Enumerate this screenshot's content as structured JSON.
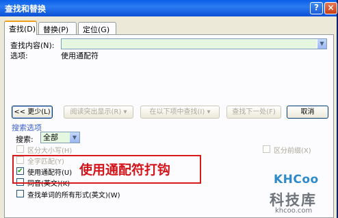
{
  "window": {
    "title": "查找和替换",
    "help_icon": "?",
    "close_icon": "×"
  },
  "tabs": [
    {
      "label": "查找(D)",
      "active": true
    },
    {
      "label": "替换(P)",
      "active": false
    },
    {
      "label": "定位(G)",
      "active": false
    }
  ],
  "find": {
    "label": "查找内容(N):",
    "value": "",
    "options_label": "选项:",
    "options_value": "使用通配符"
  },
  "buttons": {
    "less": "<< 更少(L)",
    "reading_highlight": "阅读突出显示(R) ▾",
    "find_in": "在以下项中查找(I) ▾",
    "find_next": "查找下一处(F)",
    "cancel": "取消"
  },
  "search_options": {
    "title": "搜索选项",
    "search_label": "搜索:",
    "search_value": "全部",
    "checkboxes": [
      {
        "label": "区分大小写(H)",
        "checked": false,
        "enabled": false
      },
      {
        "label": "全字匹配(Y)",
        "checked": false,
        "enabled": false
      },
      {
        "label": "使用通配符(U)",
        "checked": true,
        "enabled": true
      },
      {
        "label": "同音(英文)(K)",
        "checked": false,
        "enabled": true
      },
      {
        "label": "查找单词的所有形式(英文)(W)",
        "checked": false,
        "enabled": true
      }
    ],
    "right_checkbox": {
      "label": "区分前缀(X)",
      "checked": false,
      "enabled": false
    }
  },
  "annotation": "使用通配符打钩",
  "watermark": {
    "logo": "KHCoo",
    "name": "科技库",
    "url": "khcoo.com"
  },
  "colors": {
    "title_bar": "#0a5fe8",
    "annotation_red": "#d61a1a",
    "section_blue": "#3a5fcd"
  }
}
